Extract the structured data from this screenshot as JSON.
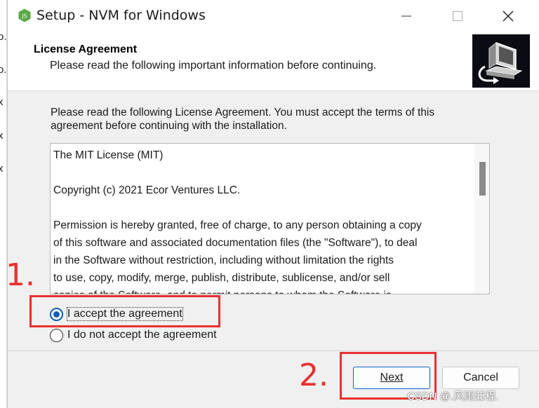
{
  "left_strip": [
    "o.",
    "o.",
    "x",
    "x",
    "x"
  ],
  "window": {
    "title": "Setup - NVM for Windows",
    "icon": "nodejs-icon",
    "controls": [
      "minimize",
      "maximize",
      "close"
    ]
  },
  "header": {
    "title": "License Agreement",
    "subtitle": "Please read the following important information before continuing."
  },
  "intro": "Please read the following License Agreement. You must accept the terms of this agreement before continuing with the installation.",
  "license": {
    "lines": [
      "The MIT License (MIT)",
      "",
      "Copyright (c) 2021 Ecor Ventures LLC.",
      "",
      "Permission is hereby granted, free of charge, to any person obtaining a copy",
      "of this software and associated documentation files (the \"Software\"), to deal",
      "in the Software without restriction, including without limitation the rights",
      "to use, copy, modify, merge, publish, distribute, sublicense, and/or sell",
      "copies of the Software, and to permit persons to whom the Software is"
    ]
  },
  "options": {
    "accept": "I accept the agreement",
    "decline": "I do not accept the agreement",
    "selected": "accept"
  },
  "buttons": {
    "next": "Next",
    "cancel": "Cancel"
  },
  "annotations": {
    "step1": "1.",
    "step2": "2.",
    "color": "#e83030"
  },
  "watermark": "CSDN @.风雨兼程."
}
